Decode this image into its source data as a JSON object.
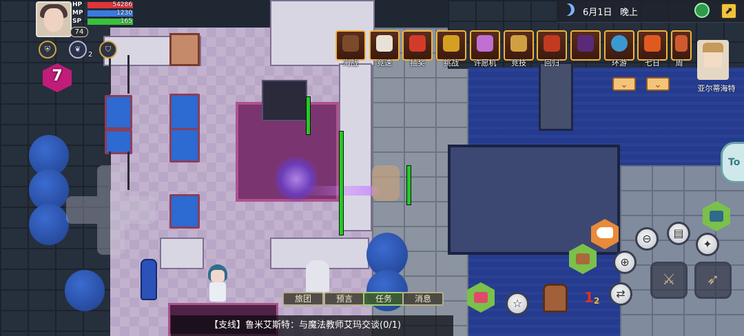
{
  "player": {
    "level": "74",
    "hp_label": "HP",
    "hp_value": "54286",
    "mp_label": "MP",
    "mp_value": "1230",
    "sp_label": "SP",
    "sp_value": "165",
    "hp_fill": 1.0,
    "mp_fill": 1.0,
    "sp_fill": 1.0
  },
  "buffs": [
    {
      "icon": "shield-emblem-icon",
      "count": ""
    },
    {
      "icon": "wing-emblem-icon",
      "count": "2"
    },
    {
      "icon": "helmet-emblem-icon",
      "count": ""
    }
  ],
  "dungeon": {
    "floor": "7"
  },
  "status_bar": {
    "date": "6月1日",
    "time_of_day": "晚上",
    "moon_icon": "moon-icon",
    "network_icon": "network-icon",
    "collapse_icon": "collapse-arrow-icon"
  },
  "top_menu": [
    {
      "label": "海战",
      "icon": "ship-icon",
      "color": "#7a4a2a"
    },
    {
      "label": "竞速",
      "icon": "race-icon",
      "color": "#e8e2d6"
    },
    {
      "label": "抽奖",
      "icon": "gift-icon",
      "color": "#d23b2a"
    },
    {
      "label": "挑战",
      "icon": "trophy-icon",
      "color": "#d4a022"
    },
    {
      "label": "许愿机",
      "icon": "wish-machine-icon",
      "color": "#c070d0"
    },
    {
      "label": "竞技",
      "icon": "arena-icon",
      "color": "#d0a040"
    },
    {
      "label": "回归",
      "icon": "lion-crest-icon",
      "color": "#c23a20"
    },
    {
      "label": "",
      "icon": "dark-crest-icon",
      "color": "#5a2a7a"
    },
    {
      "label": "环游",
      "icon": "globe-icon",
      "color": "#3a9ad0"
    },
    {
      "label": "七日",
      "icon": "seven-day-icon",
      "color": "#e05a20"
    },
    {
      "label": "周",
      "icon": "weekly-icon",
      "color": "#d05a30"
    }
  ],
  "npc": {
    "name": "亚尔蒂海特"
  },
  "chat_tabs": [
    {
      "label": "旅团"
    },
    {
      "label": "预言"
    },
    {
      "label": "任务",
      "active": true
    },
    {
      "label": "消息"
    }
  ],
  "quest_tracker": {
    "text": "【支线】鲁米艾斯特：与魔法教师艾玛交谈(0/1)"
  },
  "right_controls": {
    "side_tab": "To",
    "notification_count": "1",
    "notification_sub": "2"
  },
  "colors": {
    "hp": "#e0343a",
    "mp": "#3a7ae0",
    "sp": "#3ac03a",
    "accent": "#f0b53a"
  }
}
